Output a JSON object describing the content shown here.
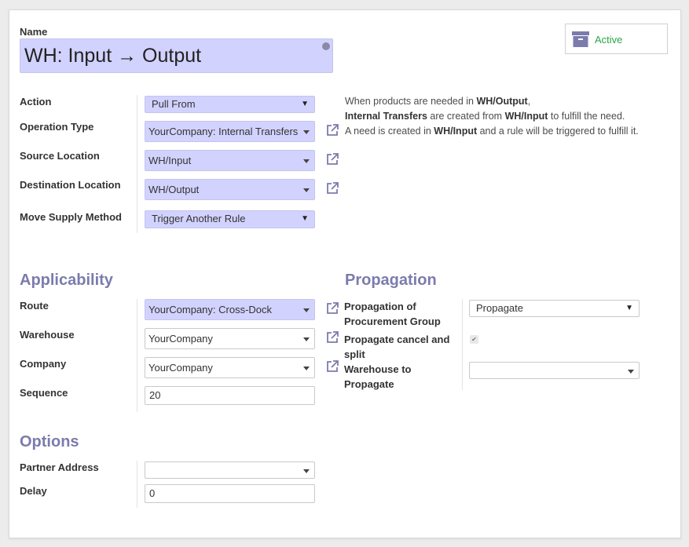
{
  "colors": {
    "accent": "#7c7bad",
    "required_bg": "#d2d2ff",
    "active_green": "#28a745"
  },
  "name": {
    "label": "Name",
    "value": "WH: Input → Output"
  },
  "active_button": {
    "label": "Active",
    "icon": "archive-icon"
  },
  "fields": {
    "action": {
      "label": "Action",
      "value": "Pull From"
    },
    "operation_type": {
      "label": "Operation Type",
      "value": "YourCompany: Internal Transfers"
    },
    "source_location": {
      "label": "Source Location",
      "value": "WH/Input"
    },
    "destination_location": {
      "label": "Destination Location",
      "value": "WH/Output"
    },
    "move_supply_method": {
      "label": "Move Supply Method",
      "value": "Trigger Another Rule"
    }
  },
  "help": {
    "line1_pre": "When products are needed in ",
    "line1_b": "WH/Output",
    ",": ",",
    "line2_b1": "Internal Transfers",
    "line2_mid": " are created from ",
    "line2_b2": "WH/Input",
    "line2_post": " to fulfill the need.",
    "line3_pre": "A need is created in ",
    "line3_b": "WH/Input",
    "line3_post": " and a rule will be triggered to fulfill it."
  },
  "applicability": {
    "title": "Applicability",
    "route": {
      "label": "Route",
      "value": "YourCompany: Cross-Dock"
    },
    "warehouse": {
      "label": "Warehouse",
      "value": "YourCompany"
    },
    "company": {
      "label": "Company",
      "value": "YourCompany"
    },
    "sequence": {
      "label": "Sequence",
      "value": "20"
    }
  },
  "propagation": {
    "title": "Propagation",
    "group": {
      "label_l1": "Propagation of",
      "label_l2": "Procurement Group",
      "value": "Propagate"
    },
    "cancel": {
      "label_l1": "Propagate cancel and",
      "label_l2": "split",
      "checked": "✔"
    },
    "warehouse": {
      "label_l1": "Warehouse to",
      "label_l2": "Propagate",
      "value": ""
    }
  },
  "options": {
    "title": "Options",
    "partner_address": {
      "label": "Partner Address",
      "value": ""
    },
    "delay": {
      "label": "Delay",
      "value": "0"
    }
  }
}
